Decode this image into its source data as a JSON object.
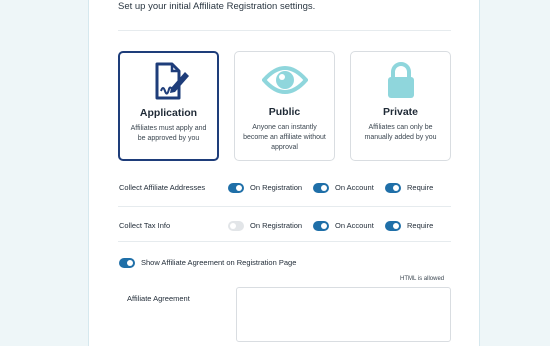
{
  "intro": "Set up your initial Affiliate Registration settings.",
  "cards": [
    {
      "title": "Application",
      "desc": "Affiliates must apply and be approved by you",
      "icon": "document-signature-icon",
      "selected": true
    },
    {
      "title": "Public",
      "desc": "Anyone can instantly become an affiliate without approval",
      "icon": "eye-icon",
      "selected": false
    },
    {
      "title": "Private",
      "desc": "Affiliates can only be manually added by you",
      "icon": "padlock-icon",
      "selected": false
    }
  ],
  "rows": {
    "addresses": {
      "label": "Collect Affiliate Addresses",
      "on_registration": {
        "label": "On Registration",
        "enabled": true
      },
      "on_account": {
        "label": "On Account",
        "enabled": true
      },
      "require": {
        "label": "Require",
        "enabled": true
      }
    },
    "tax": {
      "label": "Collect Tax Info",
      "on_registration": {
        "label": "On Registration",
        "enabled": false
      },
      "on_account": {
        "label": "On Account",
        "enabled": true
      },
      "require": {
        "label": "Require",
        "enabled": true
      }
    },
    "agreement": {
      "label": "Show Affiliate Agreement on Registration Page",
      "enabled": true
    }
  },
  "agreement_field": {
    "label": "Affiliate Agreement",
    "note": "HTML is allowed",
    "value": ""
  },
  "colors": {
    "accent": "#1f6fa8",
    "selected_border": "#1e3d7a",
    "icon_teal": "#8fd6dc",
    "icon_navy": "#1e3d7a"
  }
}
